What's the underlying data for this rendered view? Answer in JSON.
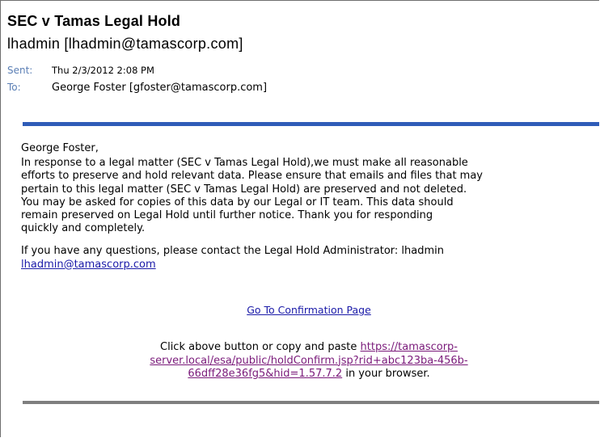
{
  "email": {
    "subject": "SEC v Tamas Legal Hold",
    "from": "lhadmin [lhadmin@tamascorp.com]",
    "sent_label": "Sent:",
    "sent_value": "Thu 2/3/2012 2:08 PM",
    "to_label": "To:",
    "to_value": "George Foster [gfoster@tamascorp.com]"
  },
  "body": {
    "greeting": "George Foster,",
    "paragraph1": "In response to a legal matter (SEC v Tamas Legal Hold),we must make all reasonable\nefforts to preserve and hold relevant data. Please ensure that emails and files that may\npertain to this legal matter (SEC v Tamas Legal Hold) are preserved and not deleted.\nYou may be asked for copies of this data by our Legal or IT team. This data should\nremain preserved on Legal Hold until further notice. Thank you for responding\nquickly and completely.",
    "paragraph2": "If you have any questions, please contact the Legal Hold Administrator: lhadmin",
    "admin_email": "lhadmin@tamascorp.com",
    "confirm_link": "Go To Confirmation Page",
    "instruction_prefix": "Click above button or copy and paste",
    "confirm_url_line1": "https://tamascorp-",
    "confirm_url_line2": "server.local/esa/public/holdConfirm.jsp?rid+abc123ba-456b-",
    "confirm_url_line3": "66dff28e36fg5&hid=1.57.7.2",
    "instruction_suffix": "in your browser."
  },
  "colors": {
    "accent_rule": "#2f5cb8",
    "bottom_rule": "#7f7f7f",
    "link": "#1a1aa8",
    "visited_link": "#7a1a7a"
  }
}
